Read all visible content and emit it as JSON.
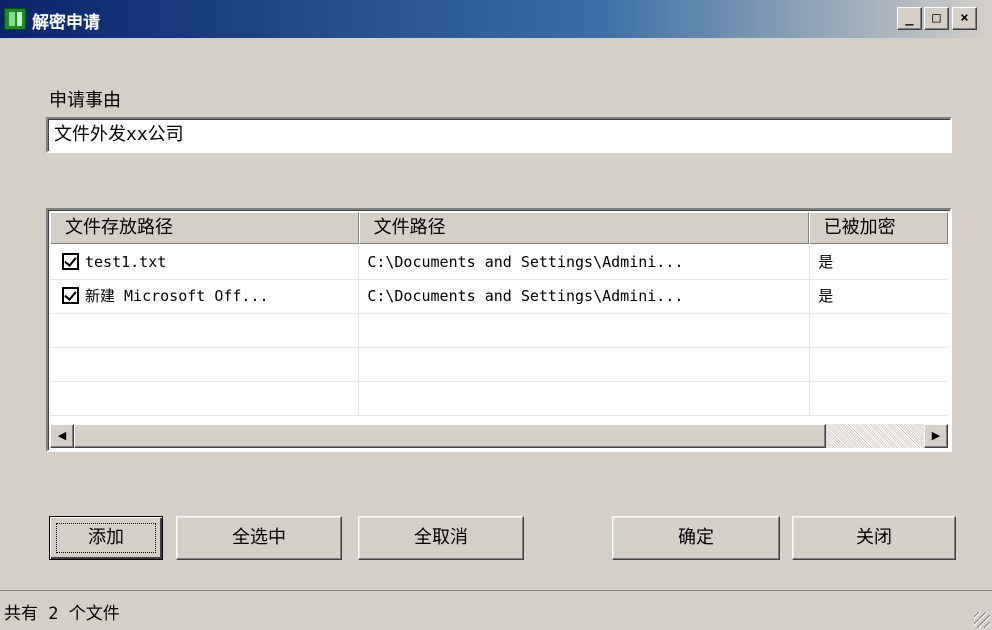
{
  "window": {
    "title": "解密申请",
    "minimize": "_",
    "maximize": "□",
    "close": "×"
  },
  "reason": {
    "label": "申请事由",
    "value": "文件外发xx公司"
  },
  "table": {
    "columns": [
      "文件存放路径",
      "文件路径",
      "已被加密"
    ],
    "rows": [
      {
        "checked": true,
        "name": "test1.txt",
        "path": "C:\\Documents and Settings\\Admini...",
        "encrypted": "是"
      },
      {
        "checked": true,
        "name": "新建 Microsoft Off...",
        "path": "C:\\Documents and Settings\\Admini...",
        "encrypted": "是"
      },
      {
        "checked": false,
        "name": "",
        "path": "",
        "encrypted": ""
      },
      {
        "checked": false,
        "name": "",
        "path": "",
        "encrypted": ""
      },
      {
        "checked": false,
        "name": "",
        "path": "",
        "encrypted": ""
      }
    ]
  },
  "buttons": {
    "add": "添加",
    "select_all": "全选中",
    "unselect_all": "全取消",
    "ok": "确定",
    "close": "关闭"
  },
  "status": {
    "text": "共有 2 个文件"
  }
}
